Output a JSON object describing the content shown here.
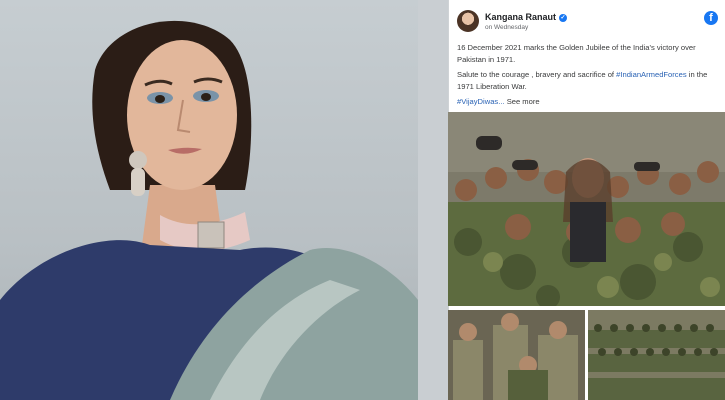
{
  "post": {
    "author": "Kangana Ranaut",
    "time": "on Wednesday",
    "paragraph1": "16 December 2021 marks the Golden Jubilee of the India's victory over Pakistan in 1971.",
    "paragraph2_pre": "Salute to the courage , bravery and sacrifice of ",
    "paragraph2_tag": "#IndianArmedForces",
    "paragraph2_post": " in the 1971 Liberation War.",
    "hashtag": "#VijayDiwas...",
    "see_more": "See more"
  },
  "icons": {
    "verified": "verified-check-icon",
    "platform": "facebook-icon"
  },
  "colors": {
    "facebook_blue": "#1877f2",
    "link_blue": "#2a63b5",
    "camouflage_green": "#5d6b3f"
  }
}
